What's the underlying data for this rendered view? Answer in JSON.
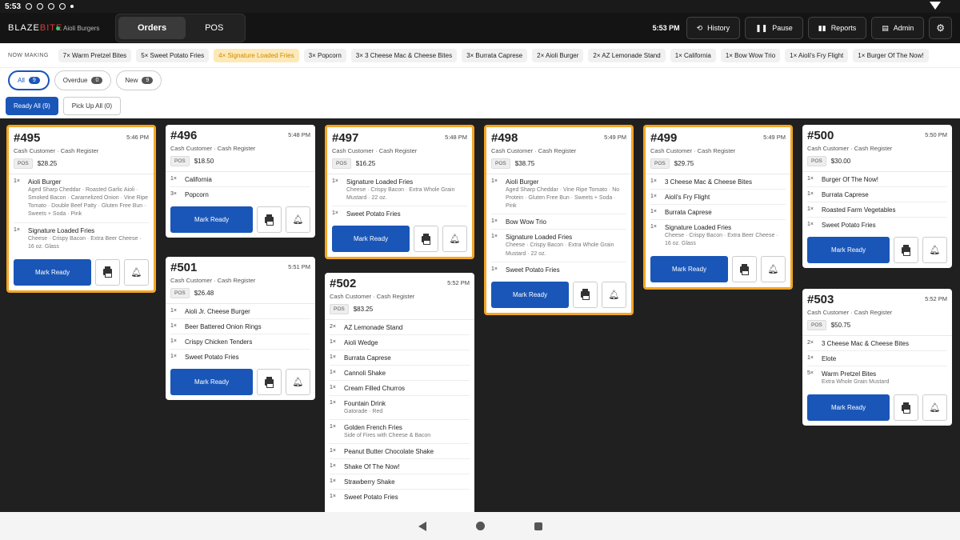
{
  "status_bar": {
    "time": "5:53"
  },
  "app": {
    "brand_a": "BLAZE",
    "brand_b": "BITE",
    "location": "Aioli Burgers",
    "modes": [
      "Orders",
      "POS"
    ],
    "clock": "5:53 PM",
    "buttons": {
      "history": "History",
      "pause": "Pause",
      "reports": "Reports",
      "admin": "Admin"
    },
    "accent": "#1a56b8",
    "highlight": "#f5a623"
  },
  "now_making": {
    "label": "NOW MAKING",
    "chips": [
      "7× Warm Pretzel Bites",
      "5× Sweet Potato Fries",
      "4× Signature Loaded Fries",
      "3× Popcorn",
      "3× 3 Cheese Mac & Cheese Bites",
      "3× Burrata Caprese",
      "2× Aioli Burger",
      "2× AZ Lemonade Stand",
      "1× California",
      "1× Bow Wow Trio",
      "1× Aioli's Fry Flight",
      "1× Burger Of The Now!"
    ]
  },
  "filters": {
    "all": {
      "label": "All",
      "count": "9"
    },
    "overdue": {
      "label": "Overdue",
      "count": "0"
    },
    "new": {
      "label": "New",
      "count": "9"
    },
    "ready_all": "Ready All (9)",
    "pickup_all": "Pick Up All (0)"
  },
  "labels": {
    "mark_ready": "Mark Ready",
    "source": "POS",
    "customer": "Cash Customer · Cash Register"
  },
  "orders": {
    "o495": {
      "num": "#495",
      "time": "5:46 PM",
      "total": "$28.25",
      "items": [
        {
          "q": "1×",
          "n": "Aioli Burger",
          "m": "Aged Sharp Cheddar · Roasted Garlic Aioli · Smoked Bacon · Caramelized Onion · Vine Ripe Tomato · Double Beef Patty · Gluten Free Bun · Sweets + Soda · Pink"
        },
        {
          "q": "1×",
          "n": "Signature Loaded Fries",
          "m": "Cheese · Crispy Bacon · Extra Beer Cheese · 16 oz. Glass"
        }
      ]
    },
    "o496": {
      "num": "#496",
      "time": "5:48 PM",
      "total": "$18.50",
      "items": [
        {
          "q": "1×",
          "n": "California",
          "m": ""
        },
        {
          "q": "3×",
          "n": "Popcorn",
          "m": ""
        }
      ]
    },
    "o497": {
      "num": "#497",
      "time": "5:48 PM",
      "total": "$16.25",
      "items": [
        {
          "q": "1×",
          "n": "Signature Loaded Fries",
          "m": "Cheese · Crispy Bacon · Extra Whole Grain Mustard · 22 oz."
        },
        {
          "q": "1×",
          "n": "Sweet Potato Fries",
          "m": ""
        }
      ]
    },
    "o498": {
      "num": "#498",
      "time": "5:49 PM",
      "total": "$38.75",
      "items": [
        {
          "q": "1×",
          "n": "Aioli Burger",
          "m": "Aged Sharp Cheddar · Vine Ripe Tomato · No Protein · Gluten Free Bun · Sweets + Soda · Pink"
        },
        {
          "q": "1×",
          "n": "Bow Wow Trio",
          "m": ""
        },
        {
          "q": "1×",
          "n": "Signature Loaded Fries",
          "m": "Cheese · Crispy Bacon · Extra Whole Grain Mustard · 22 oz."
        },
        {
          "q": "1×",
          "n": "Sweet Potato Fries",
          "m": ""
        }
      ]
    },
    "o499": {
      "num": "#499",
      "time": "5:49 PM",
      "total": "$29.75",
      "items": [
        {
          "q": "1×",
          "n": "3 Cheese Mac & Cheese Bites",
          "m": ""
        },
        {
          "q": "1×",
          "n": "Aioli's Fry Flight",
          "m": ""
        },
        {
          "q": "1×",
          "n": "Burrata Caprese",
          "m": ""
        },
        {
          "q": "1×",
          "n": "Signature Loaded Fries",
          "m": "Cheese · Crispy Bacon · Extra Beer Cheese · 16 oz. Glass"
        }
      ]
    },
    "o500": {
      "num": "#500",
      "time": "5:50 PM",
      "total": "$30.00",
      "items": [
        {
          "q": "1×",
          "n": "Burger Of The Now!",
          "m": ""
        },
        {
          "q": "1×",
          "n": "Burrata Caprese",
          "m": ""
        },
        {
          "q": "1×",
          "n": "Roasted Farm Vegetables",
          "m": ""
        },
        {
          "q": "1×",
          "n": "Sweet Potato Fries",
          "m": ""
        }
      ]
    },
    "o501": {
      "num": "#501",
      "time": "5:51 PM",
      "total": "$26.48",
      "items": [
        {
          "q": "1×",
          "n": "Aioli Jr. Cheese Burger",
          "m": ""
        },
        {
          "q": "1×",
          "n": "Beer Battered Onion Rings",
          "m": ""
        },
        {
          "q": "1×",
          "n": "Crispy Chicken Tenders",
          "m": ""
        },
        {
          "q": "1×",
          "n": "Sweet Potato Fries",
          "m": ""
        }
      ]
    },
    "o502": {
      "num": "#502",
      "time": "5:52 PM",
      "total": "$83.25",
      "items": [
        {
          "q": "2×",
          "n": "AZ Lemonade Stand",
          "m": ""
        },
        {
          "q": "1×",
          "n": "Aioli Wedge",
          "m": ""
        },
        {
          "q": "1×",
          "n": "Burrata Caprese",
          "m": ""
        },
        {
          "q": "1×",
          "n": "Cannoli Shake",
          "m": ""
        },
        {
          "q": "1×",
          "n": "Cream Filled Churros",
          "m": ""
        },
        {
          "q": "1×",
          "n": "Fountain Drink",
          "m": "Gatorade · Red"
        },
        {
          "q": "1×",
          "n": "Golden French Fries",
          "m": "Side of Fires with Cheese & Bacon"
        },
        {
          "q": "1×",
          "n": "Peanut Butter Chocolate Shake",
          "m": ""
        },
        {
          "q": "1×",
          "n": "Shake Of The Now!",
          "m": ""
        },
        {
          "q": "1×",
          "n": "Strawberry Shake",
          "m": ""
        },
        {
          "q": "1×",
          "n": "Sweet Potato Fries",
          "m": ""
        }
      ]
    },
    "o503": {
      "num": "#503",
      "time": "5:52 PM",
      "total": "$50.75",
      "items": [
        {
          "q": "2×",
          "n": "3 Cheese Mac & Cheese Bites",
          "m": ""
        },
        {
          "q": "1×",
          "n": "Elote",
          "m": ""
        },
        {
          "q": "5×",
          "n": "Warm Pretzel Bites",
          "m": "Extra Whole Grain Mustard"
        }
      ]
    }
  }
}
